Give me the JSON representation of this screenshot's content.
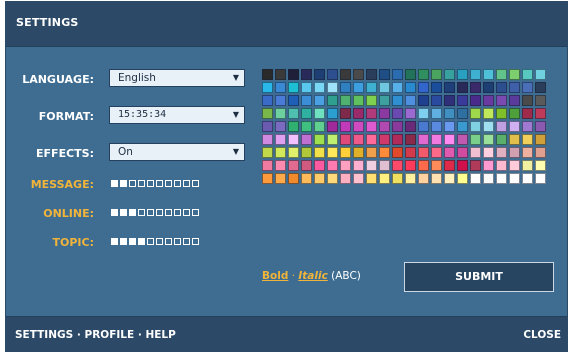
{
  "title": "SETTINGS",
  "language": {
    "label": "LANGUAGE:",
    "value": "English"
  },
  "format": {
    "label": "FORMAT:",
    "value": "15:35:34"
  },
  "effects": {
    "label": "EFFECTS:",
    "value": "On"
  },
  "message": {
    "label": "MESSAGE:",
    "filled": 2,
    "total": 10
  },
  "online": {
    "label": "ONLINE:",
    "filled": 3,
    "total": 10
  },
  "topic": {
    "label": "TOPIC:",
    "filled": 4,
    "total": 10
  },
  "format_links": {
    "bold": "Bold",
    "sep": "·",
    "italic": "Italic",
    "sample": "(ABC)"
  },
  "submit_label": "SUBMIT",
  "footer": {
    "settings": "SETTINGS",
    "sep": "·",
    "profile": "PROFILE",
    "help": "HELP",
    "close": "CLOSE"
  },
  "colors": {
    "panel": "#3f6d91",
    "bar": "#2c4a67",
    "accent": "#f0b43a",
    "text": "#ffffff"
  },
  "palette": {
    "rows": [
      [
        "#2a2a2a",
        "#3a3a3a",
        "#1f1f3a",
        "#2a2a5a",
        "#1d3f73",
        "#2d4f8f",
        "#3a3a3a",
        "#4a4a4a",
        "#2a3d5a",
        "#1e4e84",
        "#2b6cb0",
        "#23725a",
        "#2f8f5f",
        "#4aa35f",
        "#39a0a0",
        "#2aa0c0",
        "#3fb0d0",
        "#4fc0d8",
        "#62c38a",
        "#7dcf6e",
        "#58c9c0",
        "#6fd0e0"
      ],
      [
        "#29b6e8",
        "#3a89d4",
        "#1ebfd3",
        "#5ac7ee",
        "#78d7f5",
        "#9ee3f7",
        "#2f7fc1",
        "#3d9fe0",
        "#3fb0d0",
        "#6fc8e0",
        "#58b0e8",
        "#2a8ad0",
        "#3366cc",
        "#1a4e9a",
        "#1e3f7a",
        "#2a2a5a",
        "#3a2a6a",
        "#1d3f73",
        "#2d4f8f",
        "#3f5fa8",
        "#4a6fb8",
        "#2a3d5a"
      ],
      [
        "#3a6bc7",
        "#4a7bd7",
        "#1f5fb8",
        "#3b8ed6",
        "#4aa0e0",
        "#2f9f8f",
        "#4fb06f",
        "#5fc05f",
        "#7fd04f",
        "#3fa0a0",
        "#2f8fd0",
        "#4f8fe0",
        "#1f3f8f",
        "#2a4aa0",
        "#2f2f7a",
        "#3a3a9a",
        "#4a2a8a",
        "#6a3aa0",
        "#7a4ab0",
        "#5a3a9a",
        "#4a4a4a",
        "#5a5a5a"
      ],
      [
        "#7ab84a",
        "#6fd09f",
        "#4fc0b0",
        "#2fb0a0",
        "#6fe0c0",
        "#2a9fd0",
        "#7f2a4a",
        "#9a2a6a",
        "#b03a7a",
        "#8a3aa0",
        "#6a4ab0",
        "#9a6ad0",
        "#7fd0f0",
        "#5fb0e0",
        "#3f90c0",
        "#2f70a0",
        "#9fd84a",
        "#bfe85a",
        "#7fc02a",
        "#4fa03a",
        "#a02a4a",
        "#c03a5a"
      ],
      [
        "#6a5ab0",
        "#7a6ac0",
        "#2fb070",
        "#3fc080",
        "#5fd090",
        "#a02a9a",
        "#c03aba",
        "#d04ac0",
        "#e05ad0",
        "#b04ab0",
        "#8a3a9a",
        "#6a2a7a",
        "#4a7ad0",
        "#5a8ae0",
        "#6a9af0",
        "#3a9ad0",
        "#7fd0e0",
        "#9fe0f0",
        "#c0a0e0",
        "#d0b0f0",
        "#a07ad0",
        "#8a5ab0"
      ],
      [
        "#d08ae0",
        "#e0a0f0",
        "#f0c0ff",
        "#c070d0",
        "#9fe04f",
        "#bff06f",
        "#e04a7a",
        "#f05a8a",
        "#ff6a9a",
        "#d03a6a",
        "#b02a5a",
        "#8a2a4a",
        "#e06ad0",
        "#f07ae0",
        "#ff8af0",
        "#c05ab0",
        "#7ad08a",
        "#9ae09a",
        "#5ab06a",
        "#e0c04a",
        "#f0d05a",
        "#d0a03a"
      ],
      [
        "#c0d84a",
        "#d0e85a",
        "#e0f06a",
        "#b0c83a",
        "#f0e04a",
        "#ffe85a",
        "#ffd03a",
        "#e0b02a",
        "#f0a04a",
        "#ff8a3a",
        "#e04a2a",
        "#d03a4a",
        "#f05a6a",
        "#ff6a8a",
        "#e05ab0",
        "#d04aa0",
        "#f0c0d0",
        "#ffd0e0",
        "#e0b0c0",
        "#d0a0b0",
        "#f0b0a0",
        "#e0a090"
      ],
      [
        "#f07aa0",
        "#ff8ab0",
        "#e06a90",
        "#d05a80",
        "#ff5aa0",
        "#ff7ab0",
        "#ffa0c0",
        "#ffb0d0",
        "#f0d0e0",
        "#e0c0d0",
        "#ff4a6a",
        "#ff3a5a",
        "#ff6a4a",
        "#ff8a5a",
        "#e02a4a",
        "#d0104a",
        "#b03a5a",
        "#ff9ad0",
        "#ffbad0",
        "#ffcada",
        "#f0f0a0",
        "#ffffb0"
      ],
      [
        "#ff9a3a",
        "#ffaa4a",
        "#f08a2a",
        "#ffba5a",
        "#ffca6a",
        "#ffda7a",
        "#ffb0c0",
        "#ffc0d0",
        "#ffe070",
        "#fff080",
        "#f0e060",
        "#fff0a0",
        "#ffd0a0",
        "#ffe0b0",
        "#fff0c0",
        "#ffff90",
        "#ffffff",
        "#fafafa",
        "#ffffff",
        "#ffffff",
        "#ffffff",
        "#ffffff"
      ]
    ]
  }
}
